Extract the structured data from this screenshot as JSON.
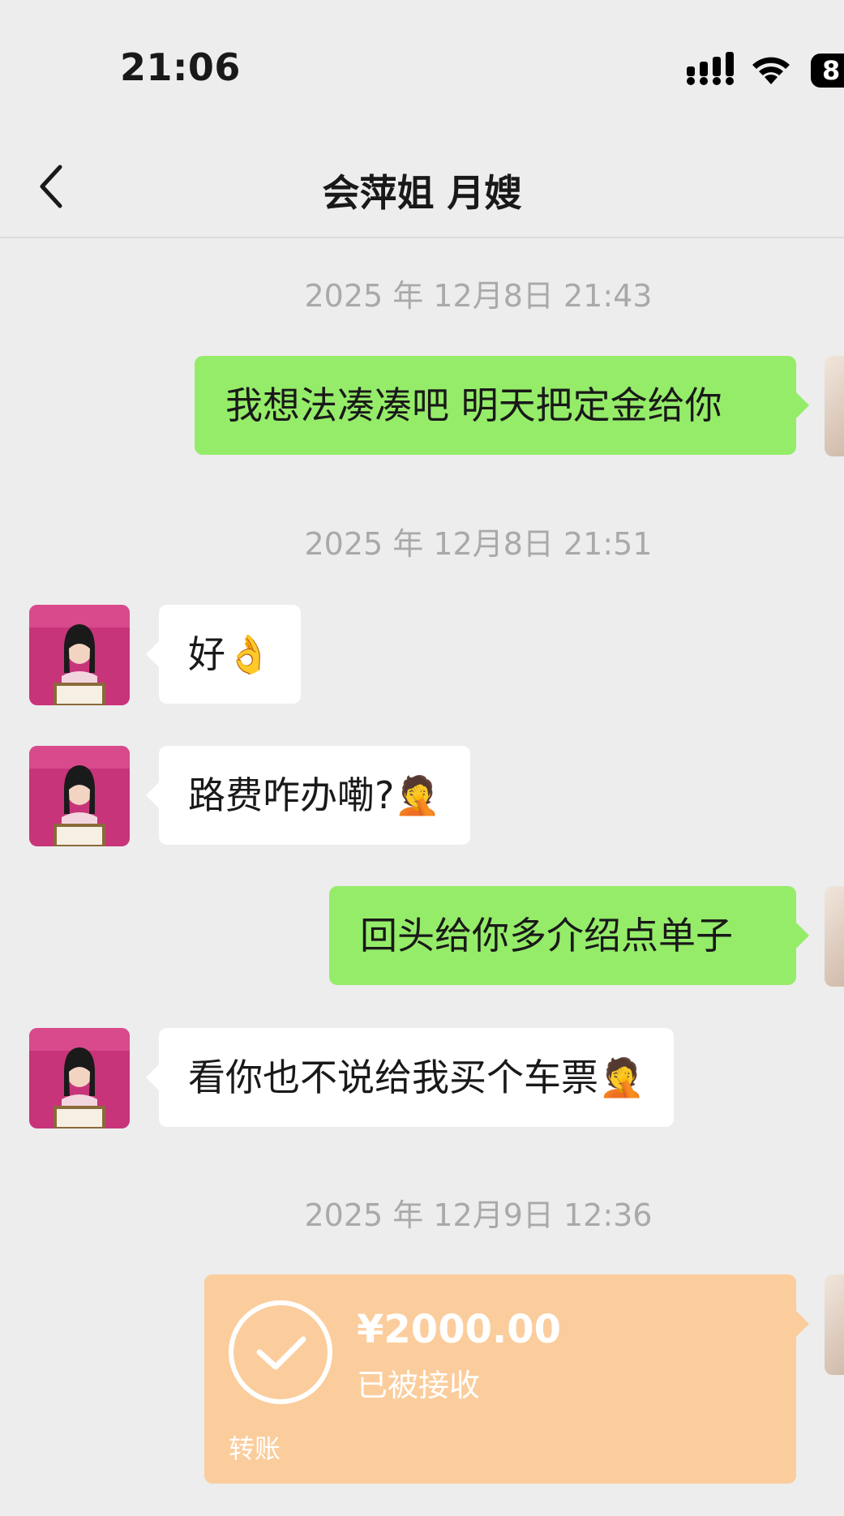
{
  "status_bar": {
    "time": "21:06",
    "battery": "8"
  },
  "header": {
    "title": "会萍姐 月嫂"
  },
  "messages": [
    {
      "timestamp": "2025 年 12月8日 21:43"
    },
    {
      "from": "me",
      "text": "我想法凑凑吧 明天把定金给你"
    },
    {
      "timestamp": "2025 年 12月8日 21:51"
    },
    {
      "from": "contact",
      "text": "好👌"
    },
    {
      "from": "contact",
      "text": "路费咋办嘞?🤦"
    },
    {
      "from": "me",
      "text": "回头给你多介绍点单子"
    },
    {
      "from": "contact",
      "text": "看你也不说给我买个车票🤦"
    },
    {
      "timestamp": "2025 年 12月9日 12:36"
    },
    {
      "from": "me",
      "type": "transfer",
      "amount": "¥2000.00",
      "status": "已被接收",
      "label": "转账"
    }
  ],
  "colors": {
    "outgoing_bubble": "#95ec69",
    "incoming_bubble": "#ffffff",
    "transfer_card": "#fbcd9d",
    "background": "#ededed"
  },
  "icons": [
    "back-icon",
    "signal-icon",
    "wifi-icon",
    "battery-icon",
    "check-icon"
  ]
}
